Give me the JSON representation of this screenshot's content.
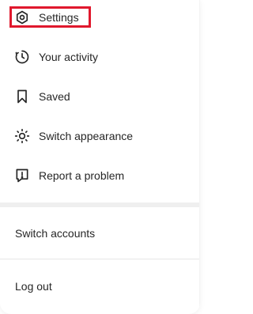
{
  "menu": {
    "items": [
      {
        "label": "Settings",
        "icon": "gear-icon"
      },
      {
        "label": "Your activity",
        "icon": "activity-icon"
      },
      {
        "label": "Saved",
        "icon": "bookmark-icon"
      },
      {
        "label": "Switch appearance",
        "icon": "sun-icon"
      },
      {
        "label": "Report a problem",
        "icon": "report-icon"
      }
    ],
    "account": {
      "switch_label": "Switch accounts",
      "logout_label": "Log out"
    },
    "highlight_color": "#e0182d"
  }
}
